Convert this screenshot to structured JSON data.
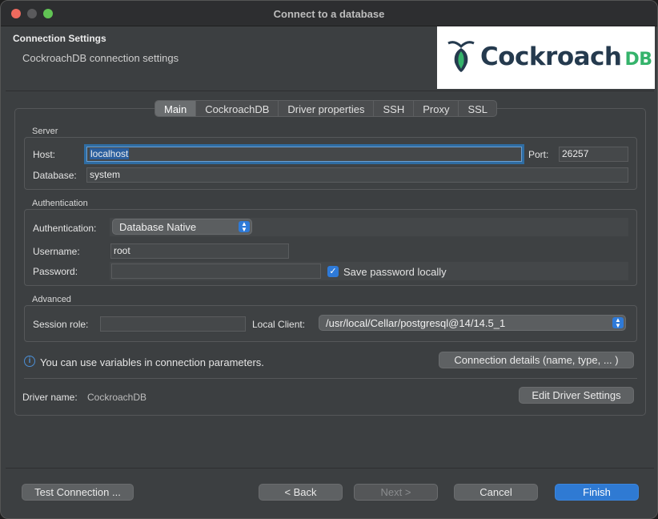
{
  "window": {
    "title": "Connect to a database"
  },
  "header": {
    "title": "Connection Settings",
    "subtitle": "CockroachDB connection settings",
    "logo_text": "Cockroach",
    "logo_suffix": "DB"
  },
  "tabs": [
    {
      "label": "Main",
      "active": true
    },
    {
      "label": "CockroachDB"
    },
    {
      "label": "Driver properties"
    },
    {
      "label": "SSH"
    },
    {
      "label": "Proxy"
    },
    {
      "label": "SSL"
    }
  ],
  "server": {
    "group_label": "Server",
    "host_label": "Host:",
    "host_value": "localhost",
    "port_label": "Port:",
    "port_value": "26257",
    "database_label": "Database:",
    "database_value": "system"
  },
  "auth": {
    "group_label": "Authentication",
    "auth_label": "Authentication:",
    "auth_value": "Database Native",
    "username_label": "Username:",
    "username_value": "root",
    "password_label": "Password:",
    "password_value": "",
    "save_password_label": "Save password locally",
    "save_password_checked": true
  },
  "advanced": {
    "group_label": "Advanced",
    "session_role_label": "Session role:",
    "session_role_value": "",
    "local_client_label": "Local Client:",
    "local_client_value": "/usr/local/Cellar/postgresql@14/14.5_1"
  },
  "info": {
    "variables_text": "You can use variables in connection parameters.",
    "connection_details_label": "Connection details (name, type, ... )"
  },
  "driver": {
    "name_label": "Driver name:",
    "name_value": "CockroachDB",
    "edit_label": "Edit Driver Settings"
  },
  "footer": {
    "test_label": "Test Connection ...",
    "back_label": "< Back",
    "next_label": "Next >",
    "cancel_label": "Cancel",
    "finish_label": "Finish"
  },
  "colors": {
    "accent": "#2f7ad3",
    "window_bg": "#3c3f41",
    "logo_dark": "#253a4e",
    "logo_green": "#35b36b"
  }
}
